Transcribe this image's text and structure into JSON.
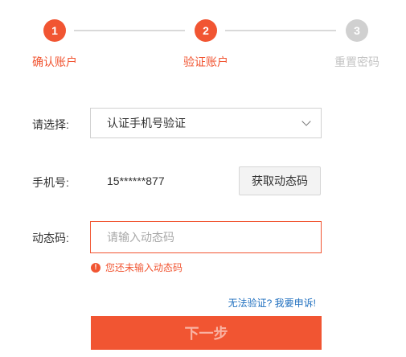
{
  "steps": [
    {
      "number": "1",
      "label": "确认账户",
      "state": "active"
    },
    {
      "number": "2",
      "label": "验证账户",
      "state": "active"
    },
    {
      "number": "3",
      "label": "重置密码",
      "state": "inactive"
    }
  ],
  "form": {
    "method_label": "请选择:",
    "method_value": "认证手机号验证",
    "phone_label": "手机号:",
    "phone_value": "15******877",
    "get_code_label": "获取动态码",
    "code_label": "动态码:",
    "code_placeholder": "请输入动态码",
    "code_value": "",
    "error_text": "您还未输入动态码",
    "help_link": "无法验证? 我要申诉!",
    "next_label": "下一步"
  },
  "colors": {
    "accent": "#f15532",
    "inactive": "#d0d0d0",
    "link": "#1f6fbf"
  }
}
